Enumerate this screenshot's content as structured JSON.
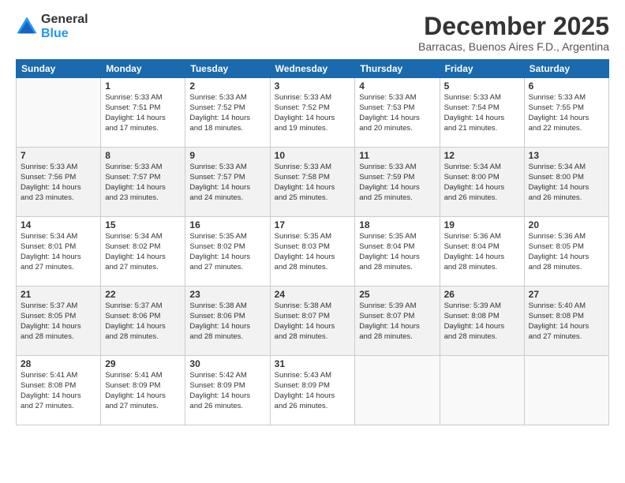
{
  "header": {
    "logo_line1": "General",
    "logo_line2": "Blue",
    "month_year": "December 2025",
    "location": "Barracas, Buenos Aires F.D., Argentina"
  },
  "weekdays": [
    "Sunday",
    "Monday",
    "Tuesday",
    "Wednesday",
    "Thursday",
    "Friday",
    "Saturday"
  ],
  "weeks": [
    [
      {
        "day": "",
        "info": ""
      },
      {
        "day": "1",
        "info": "Sunrise: 5:33 AM\nSunset: 7:51 PM\nDaylight: 14 hours\nand 17 minutes."
      },
      {
        "day": "2",
        "info": "Sunrise: 5:33 AM\nSunset: 7:52 PM\nDaylight: 14 hours\nand 18 minutes."
      },
      {
        "day": "3",
        "info": "Sunrise: 5:33 AM\nSunset: 7:52 PM\nDaylight: 14 hours\nand 19 minutes."
      },
      {
        "day": "4",
        "info": "Sunrise: 5:33 AM\nSunset: 7:53 PM\nDaylight: 14 hours\nand 20 minutes."
      },
      {
        "day": "5",
        "info": "Sunrise: 5:33 AM\nSunset: 7:54 PM\nDaylight: 14 hours\nand 21 minutes."
      },
      {
        "day": "6",
        "info": "Sunrise: 5:33 AM\nSunset: 7:55 PM\nDaylight: 14 hours\nand 22 minutes."
      }
    ],
    [
      {
        "day": "7",
        "info": "Sunrise: 5:33 AM\nSunset: 7:56 PM\nDaylight: 14 hours\nand 23 minutes."
      },
      {
        "day": "8",
        "info": "Sunrise: 5:33 AM\nSunset: 7:57 PM\nDaylight: 14 hours\nand 23 minutes."
      },
      {
        "day": "9",
        "info": "Sunrise: 5:33 AM\nSunset: 7:57 PM\nDaylight: 14 hours\nand 24 minutes."
      },
      {
        "day": "10",
        "info": "Sunrise: 5:33 AM\nSunset: 7:58 PM\nDaylight: 14 hours\nand 25 minutes."
      },
      {
        "day": "11",
        "info": "Sunrise: 5:33 AM\nSunset: 7:59 PM\nDaylight: 14 hours\nand 25 minutes."
      },
      {
        "day": "12",
        "info": "Sunrise: 5:34 AM\nSunset: 8:00 PM\nDaylight: 14 hours\nand 26 minutes."
      },
      {
        "day": "13",
        "info": "Sunrise: 5:34 AM\nSunset: 8:00 PM\nDaylight: 14 hours\nand 26 minutes."
      }
    ],
    [
      {
        "day": "14",
        "info": "Sunrise: 5:34 AM\nSunset: 8:01 PM\nDaylight: 14 hours\nand 27 minutes."
      },
      {
        "day": "15",
        "info": "Sunrise: 5:34 AM\nSunset: 8:02 PM\nDaylight: 14 hours\nand 27 minutes."
      },
      {
        "day": "16",
        "info": "Sunrise: 5:35 AM\nSunset: 8:02 PM\nDaylight: 14 hours\nand 27 minutes."
      },
      {
        "day": "17",
        "info": "Sunrise: 5:35 AM\nSunset: 8:03 PM\nDaylight: 14 hours\nand 28 minutes."
      },
      {
        "day": "18",
        "info": "Sunrise: 5:35 AM\nSunset: 8:04 PM\nDaylight: 14 hours\nand 28 minutes."
      },
      {
        "day": "19",
        "info": "Sunrise: 5:36 AM\nSunset: 8:04 PM\nDaylight: 14 hours\nand 28 minutes."
      },
      {
        "day": "20",
        "info": "Sunrise: 5:36 AM\nSunset: 8:05 PM\nDaylight: 14 hours\nand 28 minutes."
      }
    ],
    [
      {
        "day": "21",
        "info": "Sunrise: 5:37 AM\nSunset: 8:05 PM\nDaylight: 14 hours\nand 28 minutes."
      },
      {
        "day": "22",
        "info": "Sunrise: 5:37 AM\nSunset: 8:06 PM\nDaylight: 14 hours\nand 28 minutes."
      },
      {
        "day": "23",
        "info": "Sunrise: 5:38 AM\nSunset: 8:06 PM\nDaylight: 14 hours\nand 28 minutes."
      },
      {
        "day": "24",
        "info": "Sunrise: 5:38 AM\nSunset: 8:07 PM\nDaylight: 14 hours\nand 28 minutes."
      },
      {
        "day": "25",
        "info": "Sunrise: 5:39 AM\nSunset: 8:07 PM\nDaylight: 14 hours\nand 28 minutes."
      },
      {
        "day": "26",
        "info": "Sunrise: 5:39 AM\nSunset: 8:08 PM\nDaylight: 14 hours\nand 28 minutes."
      },
      {
        "day": "27",
        "info": "Sunrise: 5:40 AM\nSunset: 8:08 PM\nDaylight: 14 hours\nand 27 minutes."
      }
    ],
    [
      {
        "day": "28",
        "info": "Sunrise: 5:41 AM\nSunset: 8:08 PM\nDaylight: 14 hours\nand 27 minutes."
      },
      {
        "day": "29",
        "info": "Sunrise: 5:41 AM\nSunset: 8:09 PM\nDaylight: 14 hours\nand 27 minutes."
      },
      {
        "day": "30",
        "info": "Sunrise: 5:42 AM\nSunset: 8:09 PM\nDaylight: 14 hours\nand 26 minutes."
      },
      {
        "day": "31",
        "info": "Sunrise: 5:43 AM\nSunset: 8:09 PM\nDaylight: 14 hours\nand 26 minutes."
      },
      {
        "day": "",
        "info": ""
      },
      {
        "day": "",
        "info": ""
      },
      {
        "day": "",
        "info": ""
      }
    ]
  ]
}
